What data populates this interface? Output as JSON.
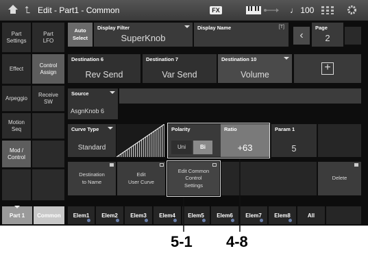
{
  "topbar": {
    "title": "Edit - Part1 - Common",
    "fx_label": "FX",
    "tempo": "♩ 100",
    "icons": [
      "home-icon",
      "back-arrow-icon",
      "keyboard-icon",
      "usb-icon",
      "grid-icon",
      "gear-icon"
    ]
  },
  "left_tabs": [
    {
      "label": "Part\nSettings"
    },
    {
      "label": "Part\nLFO"
    },
    {
      "label": "Effect"
    },
    {
      "label": "Control\nAssign"
    },
    {
      "label": "Arpeggio"
    },
    {
      "label": "Receive\nSW"
    },
    {
      "label": "Motion\nSeq"
    },
    {
      "label": ""
    },
    {
      "label": "Mod /\nControl"
    },
    {
      "label": ""
    }
  ],
  "header": {
    "auto_select": "Auto\nSelect",
    "display_filter_label": "Display Filter",
    "display_filter_value": "SuperKnob",
    "display_name_label": "Display Name",
    "page_label": "Page",
    "page_value": "2"
  },
  "destinations": [
    {
      "label": "Destination 6",
      "value": "Rev Send"
    },
    {
      "label": "Destination 7",
      "value": "Var Send"
    },
    {
      "label": "Destination 10",
      "value": "Volume"
    }
  ],
  "add_button_symbol": "+",
  "source": {
    "label": "Source",
    "value": "AsgnKnob 6"
  },
  "curve": {
    "type_label": "Curve Type",
    "type_value": "Standard"
  },
  "polarity": {
    "label": "Polarity",
    "options": [
      "Uni",
      "Bi"
    ],
    "selected": "Bi"
  },
  "ratio": {
    "label": "Ratio",
    "value": "+63"
  },
  "param1": {
    "label": "Param 1",
    "value": "5"
  },
  "buttons": {
    "destination_to_name": "Destination\nto Name",
    "edit_user_curve": "Edit\nUser Curve",
    "edit_common_control": "Edit Common\nControl\nSettings",
    "delete": "Delete"
  },
  "bottom_tabs": {
    "part": "Part 1",
    "common": "Common",
    "elements": [
      "Elem1",
      "Elem2",
      "Elem3",
      "Elem4",
      "Elem5",
      "Elem6",
      "Elem7",
      "Elem8",
      "All"
    ]
  },
  "callouts": {
    "left": "5-1",
    "right": "4-8"
  },
  "colors": {
    "screen_bg": "#0d0d0d",
    "selected_tab": "#5d5d5d",
    "ratio_selected": "#7a7a7a",
    "elem_dot": "#6a7faa"
  }
}
